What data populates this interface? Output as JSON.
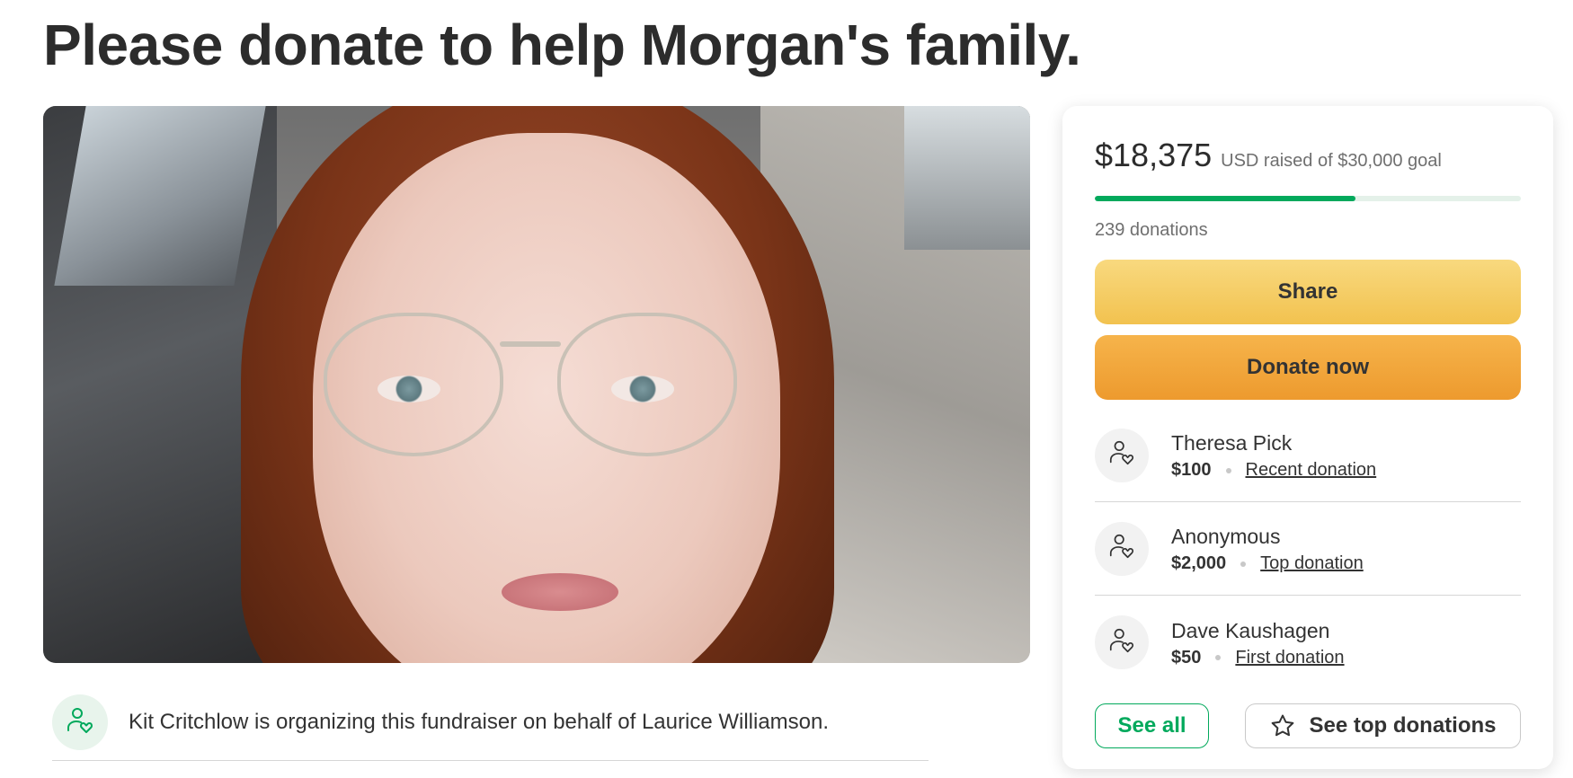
{
  "page": {
    "title": "Please donate to help Morgan's family."
  },
  "hero": {
    "image_icon": "photo-of-woman-in-car"
  },
  "organizer": {
    "icon": "heart-hand-person-icon",
    "text": "Kit Critchlow is organizing this fundraiser on behalf of Laurice Williamson."
  },
  "card": {
    "raised_amount": "$18,375",
    "raised_label": "USD raised of $30,000 goal",
    "progress_fraction": 0.6125,
    "donation_count": "239 donations",
    "share_label": "Share",
    "donate_label": "Donate now",
    "donors": [
      {
        "name": "Theresa Pick",
        "amount": "$100",
        "tag": "Recent donation"
      },
      {
        "name": "Anonymous",
        "amount": "$2,000",
        "tag": "Top donation"
      },
      {
        "name": "Dave Kaushagen",
        "amount": "$50",
        "tag": "First donation"
      }
    ],
    "see_all_label": "See all",
    "see_top_label": "See top donations"
  },
  "colors": {
    "accent_green": "#02a95c",
    "share_yellow": "#f2c24f",
    "donate_orange": "#ed9a2e"
  }
}
